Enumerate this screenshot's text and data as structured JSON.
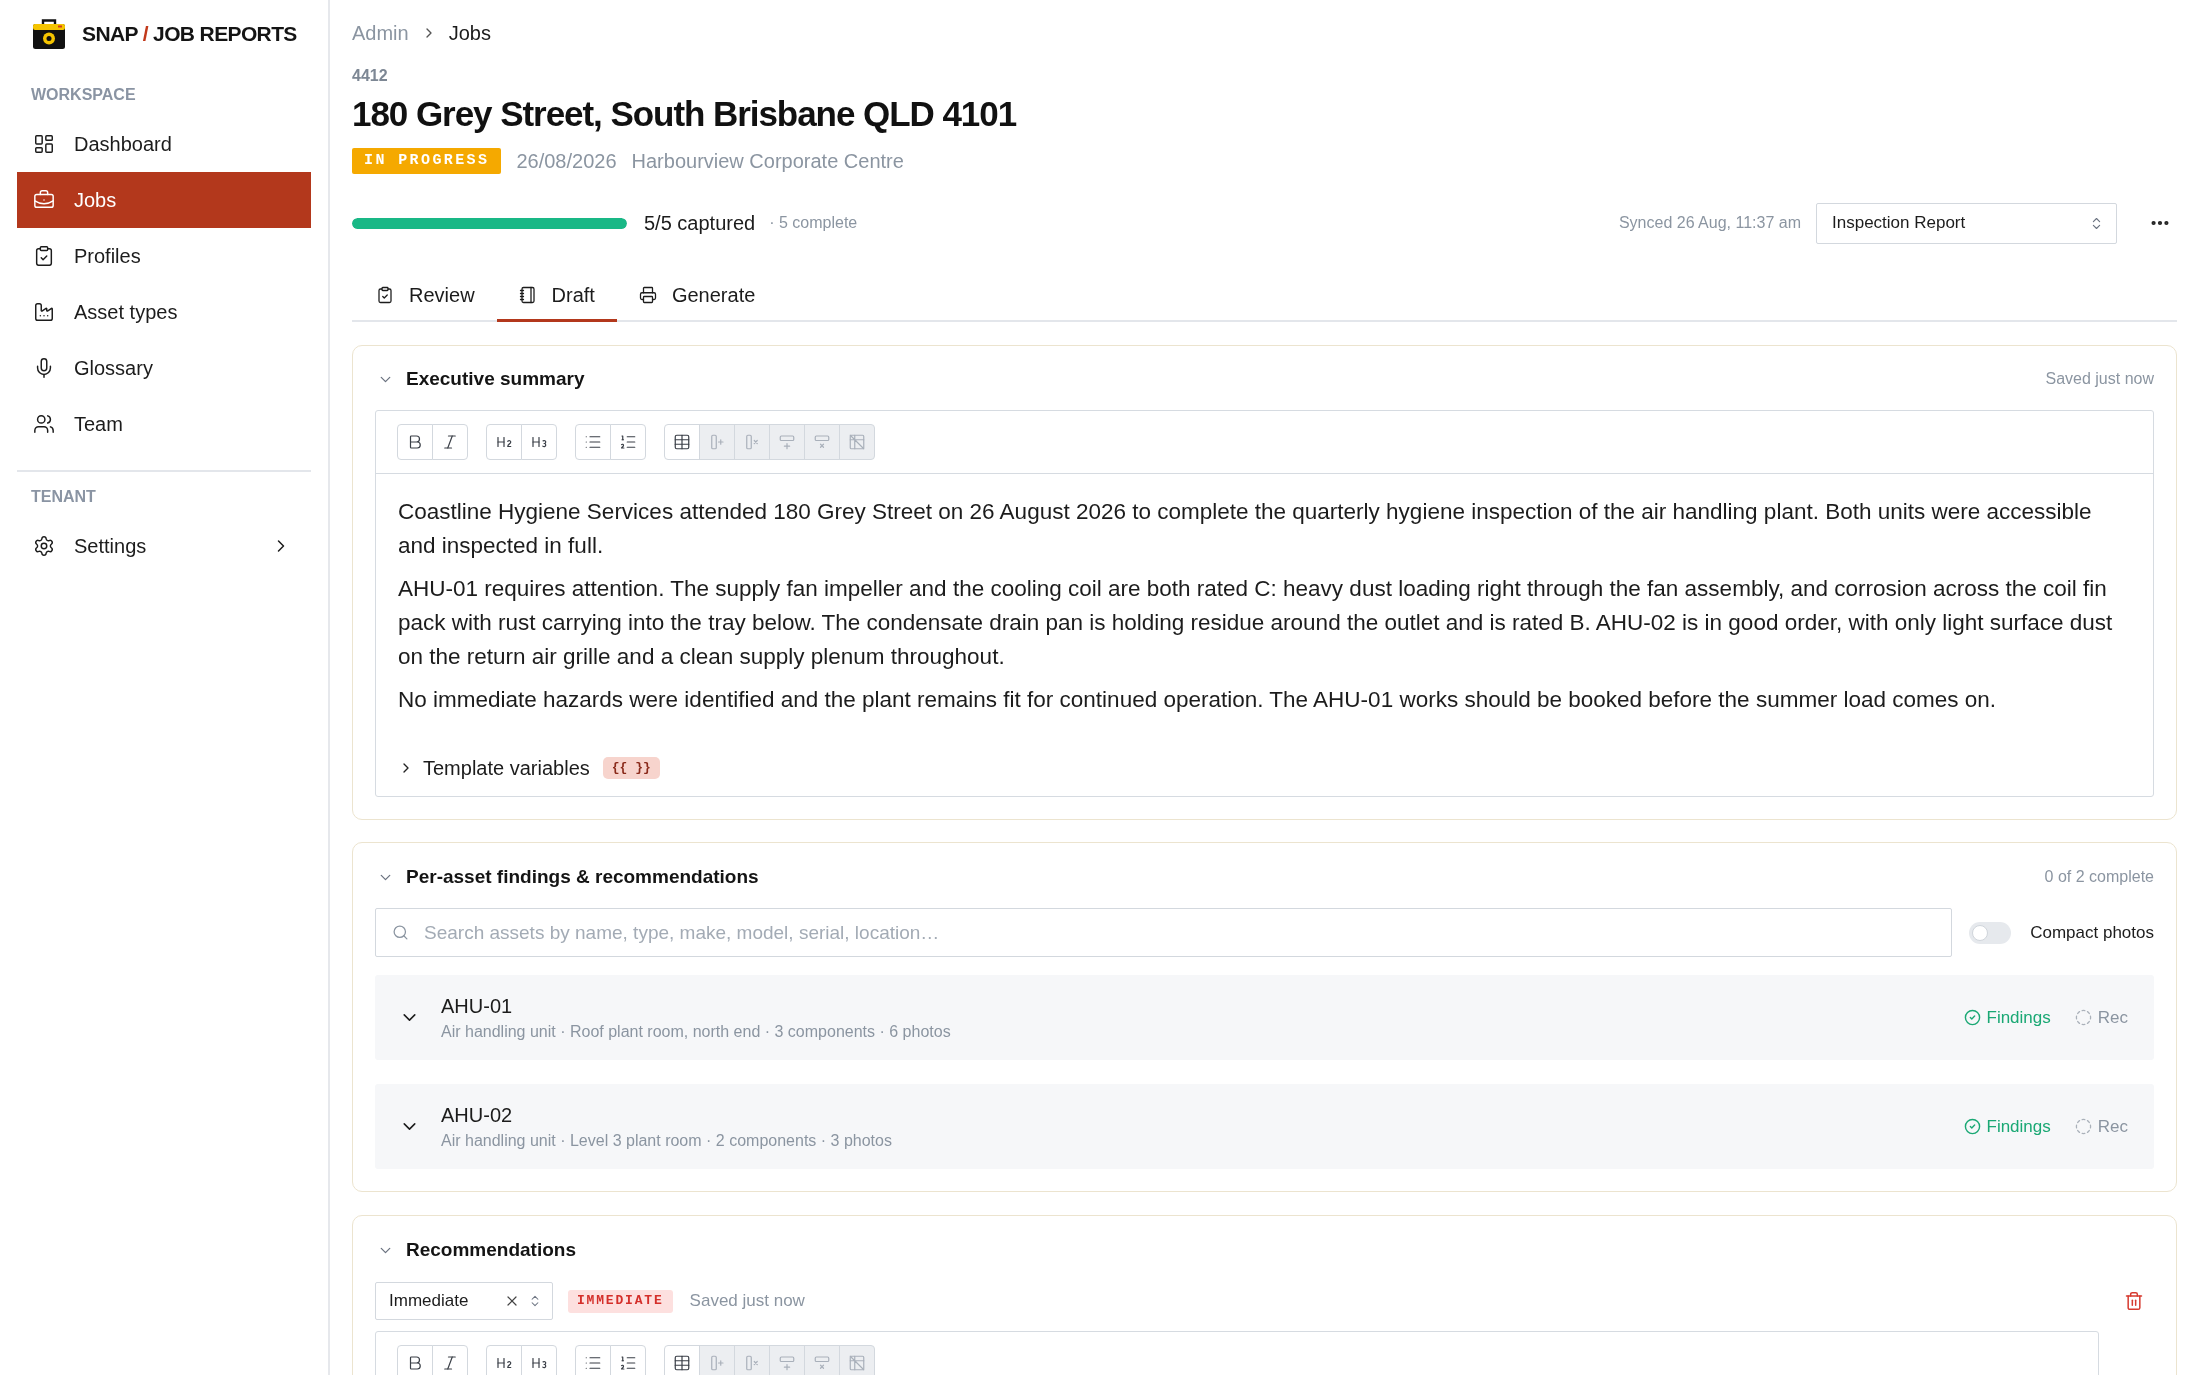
{
  "sidebar": {
    "brand": {
      "left": "SNAP",
      "separator": "/",
      "right": "JOB REPORTS"
    },
    "sections": [
      {
        "label": "WORKSPACE",
        "items": [
          {
            "label": "Dashboard",
            "selected": false,
            "expandable": false
          },
          {
            "label": "Jobs",
            "selected": true,
            "expandable": false
          },
          {
            "label": "Profiles",
            "selected": false,
            "expandable": false
          },
          {
            "label": "Asset types",
            "selected": false,
            "expandable": false
          },
          {
            "label": "Glossary",
            "selected": false,
            "expandable": false
          },
          {
            "label": "Team",
            "selected": false,
            "expandable": false
          }
        ]
      },
      {
        "label": "TENANT",
        "items": [
          {
            "label": "Settings",
            "selected": false,
            "expandable": true
          }
        ]
      }
    ]
  },
  "breadcrumb": [
    "Admin",
    "Jobs"
  ],
  "job": {
    "number": "4412",
    "title": "180 Grey Street, South Brisbane QLD 4101",
    "status": "IN PROGRESS",
    "date": "26/08/2026",
    "site": "Harbourview Corporate Centre"
  },
  "progress": {
    "level": 1,
    "captured": "5/5 captured",
    "complete": "· 5 complete"
  },
  "sync": "Synced 26 Aug, 11:37 am",
  "template_select": {
    "value": "Inspection Report"
  },
  "tabs": [
    {
      "label": "Review",
      "selected": false
    },
    {
      "label": "Draft",
      "selected": true
    },
    {
      "label": "Generate",
      "selected": false
    }
  ],
  "executive_summary": {
    "title": "Executive summary",
    "expanded": true,
    "saved": "Saved just now",
    "toolbar": [
      [
        {
          "kind": "bold",
          "disabled": false
        },
        {
          "kind": "italic",
          "disabled": false
        }
      ],
      [
        {
          "kind": "h2",
          "disabled": false
        },
        {
          "kind": "h3",
          "disabled": false
        }
      ],
      [
        {
          "kind": "bullets",
          "disabled": false
        },
        {
          "kind": "numbers",
          "disabled": false
        }
      ],
      [
        {
          "kind": "table",
          "disabled": false
        },
        {
          "kind": "addcolumn",
          "disabled": true
        },
        {
          "kind": "delcolumn",
          "disabled": true
        },
        {
          "kind": "addrow",
          "disabled": true
        },
        {
          "kind": "delrow",
          "disabled": true
        },
        {
          "kind": "deltable",
          "disabled": true
        }
      ]
    ],
    "paragraphs": [
      "Coastline Hygiene Services attended 180 Grey Street on 26 August 2026 to complete the quarterly hygiene inspection of the air handling plant. Both units were accessible and inspected in full.",
      "AHU-01 requires attention. The supply fan impeller and the cooling coil are both rated C: heavy dust loading right through the fan assembly, and corrosion across the coil fin pack with rust carrying into the tray below. The condensate drain pan is holding residue around the outlet and is rated B. AHU-02 is in good order, with only light surface dust on the return air grille and a clean supply plenum throughout.",
      "No immediate hazards were identified and the plant remains fit for continued operation. The AHU-01 works should be booked before the summer load comes on."
    ],
    "template_variables": {
      "label": "Template variables",
      "badge": "{{ }}",
      "expanded": false
    }
  },
  "findings": {
    "title": "Per-asset findings & recommendations",
    "expanded": true,
    "progress": "0 of 2 complete",
    "search": {
      "placeholder": "Search assets by name, type, make, model, serial, location…"
    },
    "compact_photos": {
      "label": "Compact photos",
      "on": false
    },
    "assets": [
      {
        "name": "AHU-01",
        "details": "Air handling unit · Roof plant room, north end · 3 components · 6 photos",
        "statuses": [
          {
            "label": "Findings",
            "done": true
          },
          {
            "label": "Rec",
            "done": false
          }
        ]
      },
      {
        "name": "AHU-02",
        "details": "Air handling unit · Level 3 plant room · 2 components · 3 photos",
        "statuses": [
          {
            "label": "Findings",
            "done": true
          },
          {
            "label": "Rec",
            "done": false
          }
        ]
      }
    ]
  },
  "recommendations": {
    "title": "Recommendations",
    "expanded": true,
    "priority": {
      "value": "Immediate"
    },
    "badge": "IMMEDIATE",
    "saved": "Saved just now",
    "toolbar": [
      [
        {
          "kind": "bold",
          "disabled": false
        },
        {
          "kind": "italic",
          "disabled": false
        }
      ],
      [
        {
          "kind": "h2",
          "disabled": false
        },
        {
          "kind": "h3",
          "disabled": false
        }
      ],
      [
        {
          "kind": "bullets",
          "disabled": false
        },
        {
          "kind": "numbers",
          "disabled": false
        }
      ],
      [
        {
          "kind": "table",
          "disabled": false
        },
        {
          "kind": "addcolumn",
          "disabled": true
        },
        {
          "kind": "delcolumn",
          "disabled": true
        },
        {
          "kind": "addrow",
          "disabled": true
        },
        {
          "kind": "delrow",
          "disabled": true
        },
        {
          "kind": "deltable",
          "disabled": true
        }
      ]
    ]
  }
}
